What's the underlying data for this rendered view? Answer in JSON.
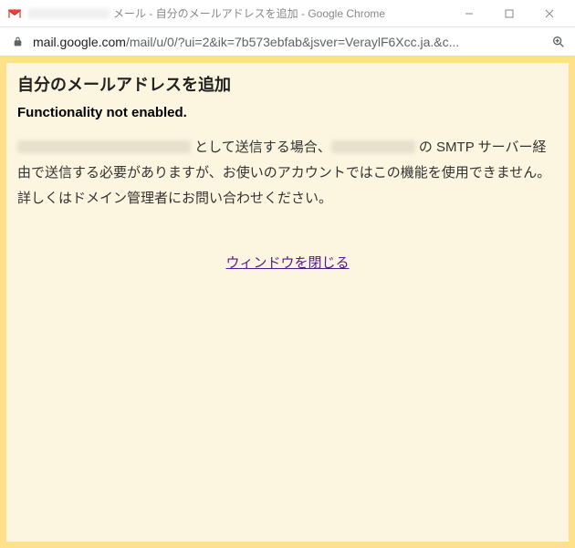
{
  "window": {
    "title_suffix": " メール - 自分のメールアドレスを追加 - Google Chrome"
  },
  "addressbar": {
    "host": "mail.google.com",
    "path": "/mail/u/0/?ui=2&ik=7b573ebfab&jsver=VeraylF6Xcc.ja.&c..."
  },
  "content": {
    "heading": "自分のメールアドレスを追加",
    "subheading": "Functionality not enabled.",
    "body_part1": " として送信する場合、",
    "body_part2": " の SMTP サーバー経由で送信する必要がありますが、お使いのアカウントではこの機能を使用できません。詳しくはドメイン管理者にお問い合わせください。",
    "close_link": "ウィンドウを閉じる"
  }
}
